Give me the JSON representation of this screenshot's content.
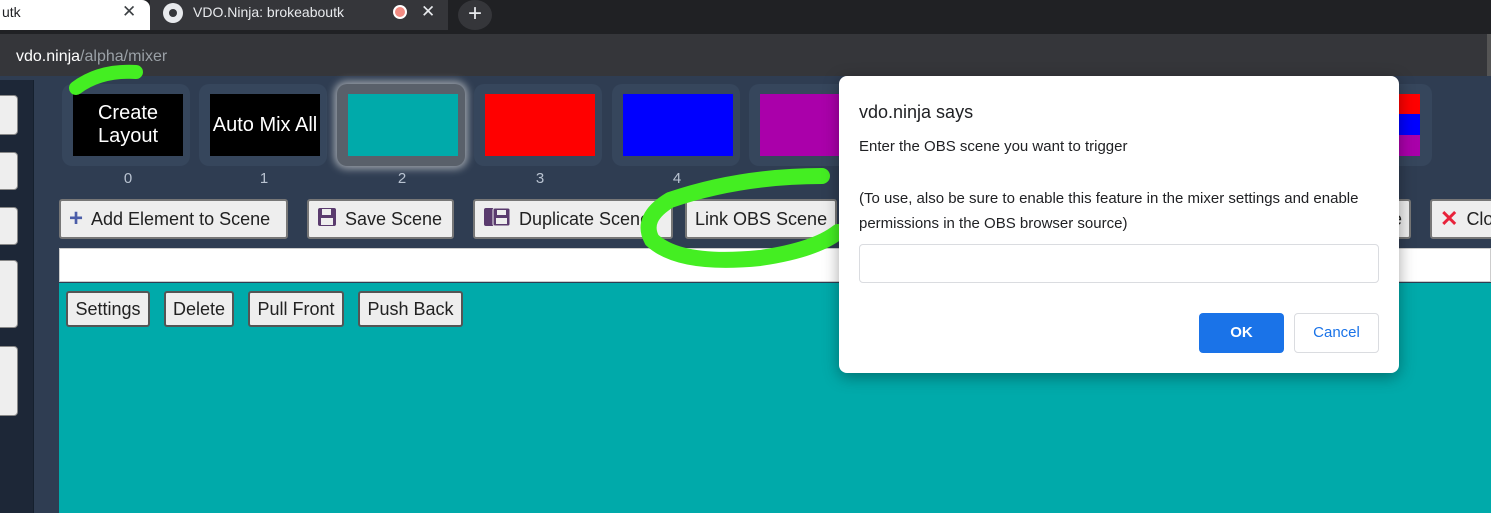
{
  "browser": {
    "tabs": [
      {
        "title": "utk",
        "close_icon": "✕"
      },
      {
        "title": "VDO.Ninja: brokeaboutk",
        "close_icon": "✕"
      }
    ],
    "new_tab_icon": "+",
    "url_host": "vdo.ninja",
    "url_path": "/alpha/mixer"
  },
  "scenes": [
    {
      "label": "Create Layout",
      "number": "0",
      "color": "#000000"
    },
    {
      "label": "Auto Mix All",
      "number": "1",
      "color": "#000000"
    },
    {
      "label": "",
      "number": "2",
      "color": "#00aaaa",
      "selected": true
    },
    {
      "label": "",
      "number": "3",
      "color": "#ff0000"
    },
    {
      "label": "",
      "number": "4",
      "color": "#0000ff"
    },
    {
      "label": "",
      "number": "",
      "color": "#aa00aa"
    }
  ],
  "toolbar": {
    "add_element": "Add Element to Scene",
    "save_scene": "Save Scene",
    "duplicate_scene": "Duplicate Scene",
    "link_obs_scene": "Link OBS Scene",
    "hidden_btn_tail": "e",
    "close": "Close"
  },
  "canvas": {
    "settings": "Settings",
    "delete": "Delete",
    "pull_front": "Pull Front",
    "push_back": "Push Back",
    "background_color": "#00aaaa"
  },
  "dialog": {
    "title": "vdo.ninja says",
    "message": "Enter the OBS scene you want to trigger",
    "note": "(To use, also be sure to enable this feature in the mixer settings and enable permissions in the OBS browser source)",
    "input_value": "",
    "ok": "OK",
    "cancel": "Cancel"
  },
  "colors": {
    "accent": "#1a73e8",
    "annotation": "#44ee22"
  }
}
